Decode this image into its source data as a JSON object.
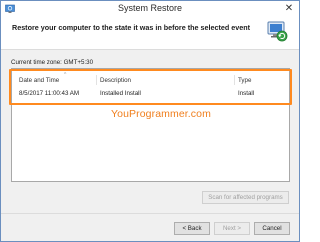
{
  "window": {
    "title": "System Restore",
    "close_glyph": "✕"
  },
  "header": {
    "instruction": "Restore your computer to the state it was in before the selected event",
    "logo_icon": "system-restore-icon"
  },
  "timezone": {
    "label": "Current time zone: GMT+5:30"
  },
  "restore_points": {
    "columns": [
      "Date and Time",
      "Description",
      "Type"
    ],
    "rows": [
      {
        "date_time": "8/5/2017 11:00:43 AM",
        "description": "Installed Install",
        "type": "Install"
      }
    ]
  },
  "watermark": "YouProgrammer.com",
  "buttons": {
    "scan": "Scan for affected programs",
    "back": "< Back",
    "next": "Next >",
    "cancel": "Cancel"
  },
  "colors": {
    "highlight": "#ff8a1f",
    "watermark": "#f07f1e"
  }
}
